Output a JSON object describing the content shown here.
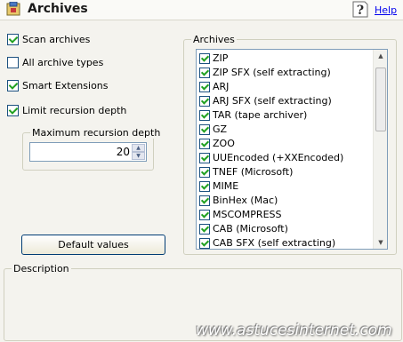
{
  "header": {
    "title": "Archives",
    "help_label": "Help"
  },
  "options": [
    {
      "label": "Scan archives",
      "checked": true
    },
    {
      "label": "All archive types",
      "checked": false
    },
    {
      "label": "Smart Extensions",
      "checked": true
    },
    {
      "label": "Limit recursion depth",
      "checked": true
    }
  ],
  "recursion": {
    "group_label": "Maximum recursion depth",
    "value": "20"
  },
  "default_button_label": "Default values",
  "archives": {
    "group_label": "Archives",
    "items": [
      {
        "label": "ZIP",
        "checked": true
      },
      {
        "label": "ZIP SFX (self extracting)",
        "checked": true
      },
      {
        "label": "ARJ",
        "checked": true
      },
      {
        "label": "ARJ SFX (self extracting)",
        "checked": true
      },
      {
        "label": "TAR (tape archiver)",
        "checked": true
      },
      {
        "label": "GZ",
        "checked": true
      },
      {
        "label": "ZOO",
        "checked": true
      },
      {
        "label": "UUEncoded (+XXEncoded)",
        "checked": true
      },
      {
        "label": "TNEF (Microsoft)",
        "checked": true
      },
      {
        "label": "MIME",
        "checked": true
      },
      {
        "label": "BinHex (Mac)",
        "checked": true
      },
      {
        "label": "MSCOMPRESS",
        "checked": true
      },
      {
        "label": "CAB (Microsoft)",
        "checked": true
      },
      {
        "label": "CAB SFX (self extracting)",
        "checked": true
      }
    ]
  },
  "description": {
    "group_label": "Description"
  },
  "watermark": "www.astucesinternet.com"
}
